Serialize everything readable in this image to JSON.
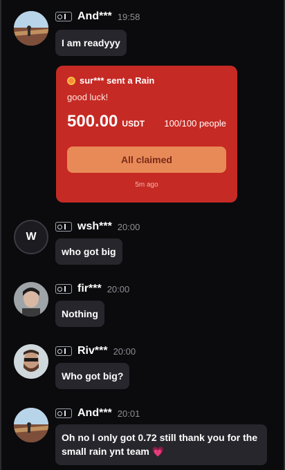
{
  "messages": [
    {
      "user": "And***",
      "time": "19:58",
      "text": "I am readyyy"
    },
    {
      "user": "wsh***",
      "time": "20:00",
      "text": "who got big",
      "avatar_letter": "W"
    },
    {
      "user": "fir***",
      "time": "20:00",
      "text": "Nothing"
    },
    {
      "user": "Riv***",
      "time": "20:00",
      "text": "Who got big?"
    },
    {
      "user": "And***",
      "time": "20:01",
      "text_line1": "Oh no I only got 0.72 still thank you for the",
      "text_line2": "small rain ynt team",
      "emoji": "💗"
    }
  ],
  "rain_card": {
    "sender": "sur*** sent a Rain",
    "message": "good luck!",
    "amount": "500.00",
    "currency": "USDT",
    "people": "100/100 people",
    "button": "All claimed",
    "ago": "5m ago"
  },
  "colors": {
    "background": "#0b0b0d",
    "bubble": "#26262c",
    "rain_card": "#c62a24",
    "claimed_button": "#e88a58"
  }
}
